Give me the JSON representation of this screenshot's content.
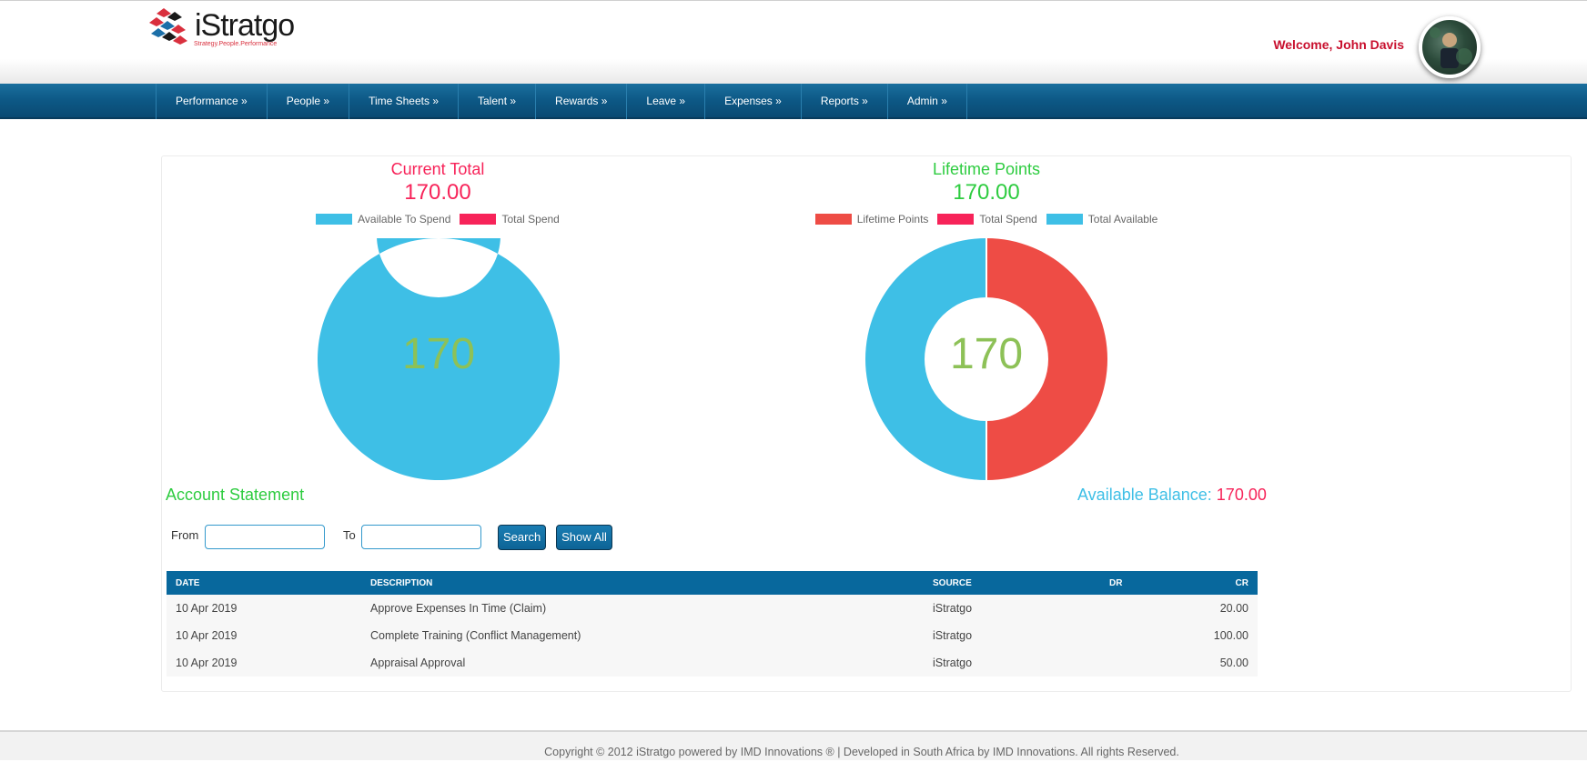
{
  "brand": {
    "name": "iStratgo",
    "tagline": "Strategy.People.Performance"
  },
  "header": {
    "welcome": "Welcome, John Davis"
  },
  "nav": {
    "items": [
      "Performance »",
      "People »",
      "Time Sheets »",
      "Talent »",
      "Rewards »",
      "Leave »",
      "Expenses »",
      "Reports »",
      "Admin »"
    ]
  },
  "current_total": {
    "title": "Current Total",
    "total": "170.00",
    "center_value": "170",
    "legend": [
      {
        "label": "Available To Spend",
        "color": "#3ebfe6"
      },
      {
        "label": "Total Spend",
        "color": "#f72359"
      }
    ]
  },
  "lifetime_points": {
    "title": "Lifetime Points",
    "total": "170.00",
    "center_value": "170",
    "legend": [
      {
        "label": "Lifetime Points",
        "color": "#ee4c45"
      },
      {
        "label": "Total Spend",
        "color": "#f72359"
      },
      {
        "label": "Total Available",
        "color": "#3ebfe6"
      }
    ]
  },
  "chart_data": [
    {
      "type": "pie",
      "categories": [
        "Available To Spend",
        "Total Spend"
      ],
      "values": [
        170,
        0
      ],
      "colors": [
        "#3ebfe6",
        "#f72359"
      ],
      "title": "Current Total"
    },
    {
      "type": "pie",
      "categories": [
        "Lifetime Points",
        "Total Spend",
        "Total Available"
      ],
      "values": [
        170,
        0,
        170
      ],
      "colors": [
        "#ee4c45",
        "#f72359",
        "#3ebfe6"
      ],
      "title": "Lifetime Points"
    }
  ],
  "statement": {
    "title": "Account Statement",
    "balance_label": "Available Balance:",
    "balance_value": "170.00",
    "from_label": "From",
    "to_label": "To",
    "search_label": "Search",
    "show_all_label": "Show All",
    "columns": [
      "DATE",
      "DESCRIPTION",
      "SOURCE",
      "DR",
      "CR"
    ],
    "rows": [
      [
        "10 Apr 2019",
        "Approve Expenses In Time (Claim)",
        "iStratgo",
        "",
        "20.00"
      ],
      [
        "10 Apr 2019",
        "Complete Training (Conflict Management)",
        "iStratgo",
        "",
        "100.00"
      ],
      [
        "10 Apr 2019",
        "Appraisal Approval",
        "iStratgo",
        "",
        "50.00"
      ]
    ]
  },
  "footer": {
    "text": "Copyright © 2012 iStratgo powered by IMD Innovations ® | Developed in South Africa by IMD Innovations. All rights Reserved."
  },
  "colors": {
    "nav_bg": "#0d5885",
    "title_red": "#f72359",
    "title_green": "#2ecc40",
    "balance_blue": "#3ebfe6",
    "center_green": "#8dc157"
  }
}
